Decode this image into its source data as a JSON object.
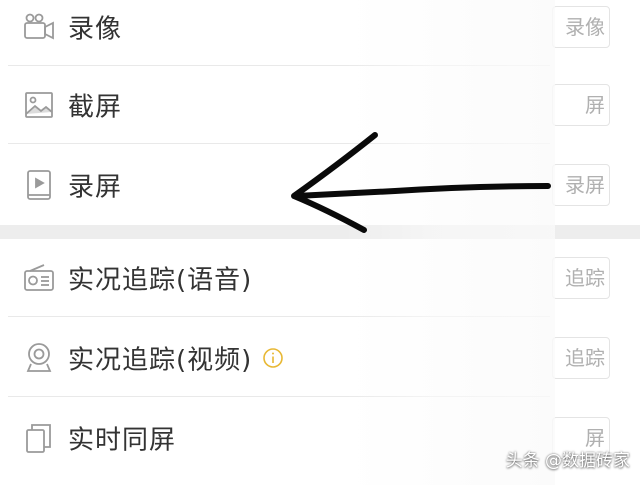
{
  "rows": [
    {
      "label": "录像",
      "action": "录像",
      "icon": "video-camera-icon"
    },
    {
      "label": "截屏",
      "action": "屏",
      "icon": "image-icon"
    },
    {
      "label": "录屏",
      "action": "录屏",
      "icon": "tablet-play-icon"
    },
    {
      "label": "实况追踪(语音)",
      "action": "追踪",
      "icon": "radio-icon"
    },
    {
      "label": "实况追踪(视频)",
      "action": "追踪",
      "icon": "webcam-icon",
      "info_icon": "info-circle-icon"
    },
    {
      "label": "实时同屏",
      "action": "屏",
      "icon": "mirror-screen-icon"
    }
  ],
  "watermark": "头条 @数据砖家",
  "colors": {
    "label": "#333333",
    "icon": "#9a9a9a",
    "info": "#e8b834",
    "button_text": "#b0b0b0",
    "arrow": "#0a0a0a"
  }
}
